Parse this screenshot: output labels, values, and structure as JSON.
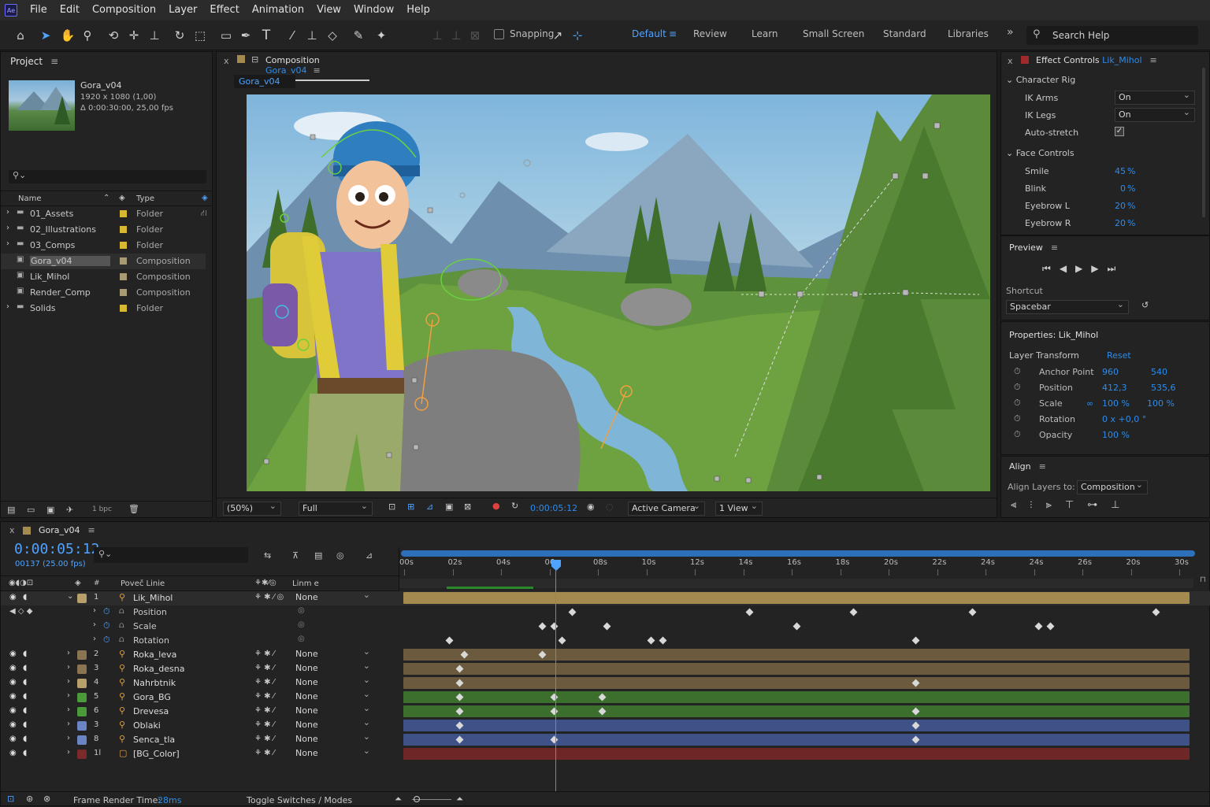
{
  "menu": [
    "File",
    "Edit",
    "Composition",
    "Layer",
    "Effect",
    "Animation",
    "View",
    "Window",
    "Help"
  ],
  "toolbar": {
    "snapping": "Snapping",
    "workspaces": [
      "Default",
      "Review",
      "Learn",
      "Small Screen",
      "Standard",
      "Libraries"
    ],
    "active_workspace": "Default",
    "search_placeholder": "Search Help"
  },
  "project": {
    "title": "Project",
    "comp_name": "Gora_v04",
    "comp_size": "1920 x 1080 (1,00)",
    "comp_duration": "Δ 0:00:30:00, 25,00 fps",
    "col_name": "Name",
    "col_type": "Type",
    "items": [
      {
        "name": "01_Assets",
        "type": "Folder"
      },
      {
        "name": "02_Illustrations",
        "type": "Folder"
      },
      {
        "name": "03_Comps",
        "type": "Folder"
      },
      {
        "name": "Gora_v04",
        "type": "Composition"
      },
      {
        "name": "Lik_Mihol",
        "type": "Composition"
      },
      {
        "name": "Render_Comp",
        "type": "Composition"
      },
      {
        "name": "Solids",
        "type": "Folder"
      }
    ],
    "bpc": "1 bpc"
  },
  "comp": {
    "tab_label": "Composition",
    "tab_name": "Gora_v04",
    "flow_tab": "Gora_v04",
    "zoom": "(50%)",
    "resolution": "Full",
    "timecode": "0:00:05:12",
    "camera": "Active Camera",
    "views": "1 View"
  },
  "effects": {
    "title": "Effect Controls",
    "layer": "Lik_Mihol",
    "group1": "Character Rig",
    "ik_arms_label": "IK Arms",
    "ik_arms": "On",
    "ik_legs_label": "IK Legs",
    "ik_legs": "On",
    "autostretch": "Auto-stretch",
    "group2": "Face Controls",
    "face": [
      {
        "name": "Smile",
        "value": "45",
        "unit": "%"
      },
      {
        "name": "Blink",
        "value": "0",
        "unit": "%"
      },
      {
        "name": "Eyebrow L",
        "value": "20",
        "unit": "%"
      },
      {
        "name": "Eyebrow R",
        "value": "20",
        "unit": "%"
      }
    ]
  },
  "preview": {
    "title": "Preview",
    "shortcut_label": "Shortcut",
    "shortcut": "Spacebar"
  },
  "properties": {
    "title": "Properties: Lik_Mihol",
    "section": "Layer Transform",
    "reset": "Reset",
    "rows": [
      {
        "name": "Anchor Point",
        "v1": "960",
        "v2": "540"
      },
      {
        "name": "Position",
        "v1": "412,3",
        "v2": "535,6"
      },
      {
        "name": "Scale",
        "v1": "100 %",
        "v2": "100 %"
      },
      {
        "name": "Rotation",
        "v1": "0 x +0,0 °",
        "v2": ""
      },
      {
        "name": "Opacity",
        "v1": "100 %",
        "v2": ""
      }
    ]
  },
  "align": {
    "title": "Align",
    "label": "Align Layers to:",
    "target": "Composition"
  },
  "timeline": {
    "tab": "Gora_v04",
    "timecode": "0:00:05:12",
    "frames": "00137 (25.00 fps)",
    "col_source": "Poveč Linie",
    "col_parent": "Linm e",
    "col_hash": "#",
    "ruler": [
      "00s",
      "02s",
      "04s",
      "06s",
      "08s",
      "10s",
      "12s",
      "14s",
      "16s",
      "18s",
      "20s",
      "22s",
      "24s",
      "24s",
      "26s",
      "20s",
      "30s"
    ],
    "layers": [
      {
        "num": "1",
        "name": "Lik_Mihol",
        "parent": "None",
        "color": "#b8a06a",
        "bar": "#a48a4e"
      },
      {
        "num": "2",
        "name": "Roka_leva",
        "parent": "None",
        "color": "#8a7452",
        "bar": "#6b5a3e"
      },
      {
        "num": "3",
        "name": "Roka_desna",
        "parent": "None",
        "color": "#8a7452",
        "bar": "#6b5a3e"
      },
      {
        "num": "4",
        "name": "Nahrbtnik",
        "parent": "None",
        "color": "#b8a06a",
        "bar": "#6b5a3e"
      },
      {
        "num": "5",
        "name": "Gora_BG",
        "parent": "None",
        "color": "#4a9a3a",
        "bar": "#3c6e2e"
      },
      {
        "num": "6",
        "name": "Drevesa",
        "parent": "None",
        "color": "#4a9a3a",
        "bar": "#3c6e2e"
      },
      {
        "num": "3",
        "name": "Oblaki",
        "parent": "None",
        "color": "#6a84c4",
        "bar": "#3e5288"
      },
      {
        "num": "8",
        "name": "Senca_tla",
        "parent": "None",
        "color": "#6a84c4",
        "bar": "#3e5288"
      },
      {
        "num": "1l",
        "name": "[BG_Color]",
        "parent": "None",
        "color": "#7a2a2a",
        "bar": "#6e2626"
      }
    ],
    "props": [
      "Position",
      "Scale",
      "Rotation"
    ],
    "footer_label": "Frame Render Time:",
    "footer_value": "28ms",
    "toggle": "Toggle Switches / Modes"
  }
}
